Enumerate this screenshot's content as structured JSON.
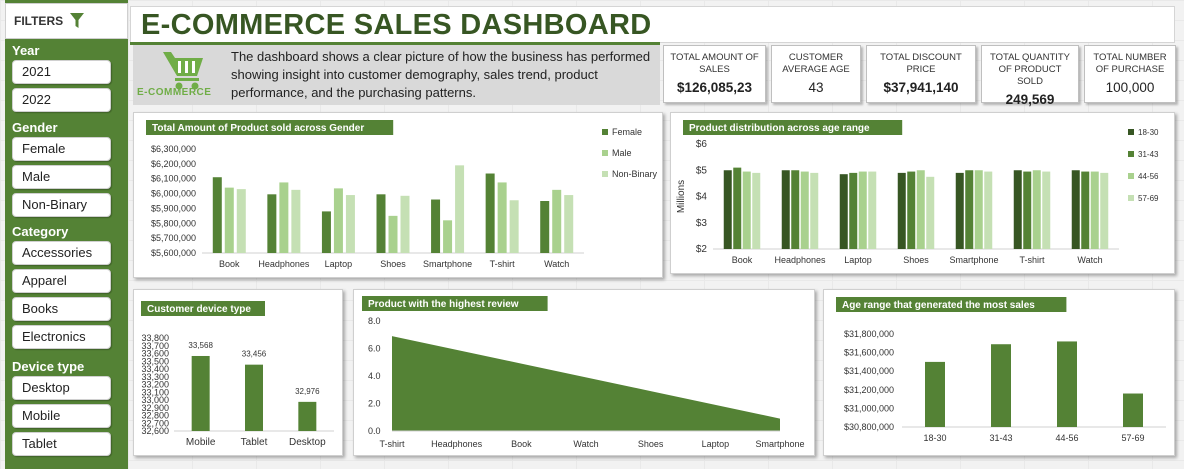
{
  "filters": {
    "label": "FILTERS",
    "groups": [
      {
        "title": "Year",
        "items": [
          "2021",
          "2022"
        ]
      },
      {
        "title": "Gender",
        "items": [
          "Female",
          "Male",
          "Non-Binary"
        ]
      },
      {
        "title": "Category",
        "items": [
          "Accessories",
          "Apparel",
          "Books",
          "Electronics"
        ]
      },
      {
        "title": "Device type",
        "items": [
          "Desktop",
          "Mobile",
          "Tablet"
        ]
      }
    ]
  },
  "header": {
    "title": "E-COMMERCE SALES DASHBOARD",
    "logo_text": "E-COMMERCE",
    "description": "The dashboard shows a clear picture of how the business has performed showing insight into customer demography, sales trend, product performance, and the purchasing patterns."
  },
  "kpis": [
    {
      "label": "TOTAL AMOUNT OF SALES",
      "value": "$126,085,23"
    },
    {
      "label": "CUSTOMER AVERAGE AGE",
      "value": "43"
    },
    {
      "label": "TOTAL DISCOUNT PRICE",
      "value": "$37,941,140"
    },
    {
      "label": "TOTAL QUANTITY OF PRODUCT SOLD",
      "value": "249,569"
    },
    {
      "label": "TOTAL NUMBER OF PURCHASE",
      "value": "100,000"
    }
  ],
  "colors": {
    "dark": "#548235",
    "mid": "#a9d18e",
    "light": "#c5e0b4",
    "vdark": "#375623",
    "title": "#375623"
  },
  "chart_data": [
    {
      "id": "gender",
      "type": "bar",
      "title": "Total Amount of Product sold across Gender",
      "categories": [
        "Book",
        "Headphones",
        "Laptop",
        "Shoes",
        "Smartphone",
        "T-shirt",
        "Watch"
      ],
      "series": [
        {
          "name": "Female",
          "values": [
            6110000,
            5995000,
            5880000,
            5995000,
            5960000,
            6135000,
            5950000
          ]
        },
        {
          "name": "Male",
          "values": [
            6040000,
            6075000,
            6035000,
            5850000,
            5820000,
            6075000,
            6025000
          ]
        },
        {
          "name": "Non-Binary",
          "values": [
            6030000,
            6025000,
            5990000,
            5985000,
            6190000,
            5955000,
            5990000
          ]
        }
      ],
      "yticks": [
        "$5,600,000",
        "$5,700,000",
        "$5,800,000",
        "$5,900,000",
        "$6,000,000",
        "$6,100,000",
        "$6,200,000",
        "$6,300,000"
      ],
      "ylim": [
        5600000,
        6300000
      ],
      "legend": "right"
    },
    {
      "id": "age",
      "type": "bar",
      "title": "Product distribution across age range",
      "ylabel": "Millions",
      "categories": [
        "Book",
        "Headphones",
        "Laptop",
        "Shoes",
        "Smartphone",
        "T-shirt",
        "Watch"
      ],
      "series": [
        {
          "name": "18-30",
          "values": [
            5.0,
            5.0,
            4.85,
            4.9,
            4.9,
            5.0,
            5.0
          ]
        },
        {
          "name": "31-43",
          "values": [
            5.1,
            5.0,
            4.9,
            4.95,
            5.0,
            4.95,
            4.95
          ]
        },
        {
          "name": "44-56",
          "values": [
            4.95,
            4.95,
            4.95,
            5.0,
            5.0,
            5.0,
            4.95
          ]
        },
        {
          "name": "57-69",
          "values": [
            4.9,
            4.9,
            4.95,
            4.75,
            4.95,
            4.95,
            4.9
          ]
        }
      ],
      "yticks": [
        "$2",
        "$3",
        "$4",
        "$5",
        "$6"
      ],
      "ylim": [
        2,
        6
      ],
      "legend": "right"
    },
    {
      "id": "device",
      "type": "bar",
      "title": "Customer device type",
      "categories": [
        "Mobile",
        "Tablet",
        "Desktop"
      ],
      "values": [
        33568,
        33456,
        32976
      ],
      "data_labels": [
        "33,568",
        "33,456",
        "32,976"
      ],
      "yticks": [
        "32,600",
        "32,700",
        "32,800",
        "32,900",
        "33,000",
        "33,100",
        "33,200",
        "33,300",
        "33,400",
        "33,500",
        "33,600",
        "33,700",
        "33,800"
      ],
      "ylim": [
        32600,
        33800
      ]
    },
    {
      "id": "review",
      "type": "area",
      "title": "Product with the highest review",
      "categories": [
        "T-shirt",
        "Headphones",
        "Book",
        "Watch",
        "Shoes",
        "Laptop",
        "Smartphone"
      ],
      "values": [
        6.9,
        5.9,
        4.9,
        3.9,
        2.9,
        1.9,
        0.9
      ],
      "yticks": [
        "0.0",
        "2.0",
        "4.0",
        "6.0",
        "8.0"
      ],
      "ylim": [
        0,
        8
      ]
    },
    {
      "id": "agesales",
      "type": "bar",
      "title": "Age range that generated the most sales",
      "categories": [
        "18-30",
        "31-43",
        "44-56",
        "57-69"
      ],
      "values": [
        31500000,
        31690000,
        31720000,
        31160000
      ],
      "yticks": [
        "$30,800,000",
        "$31,000,000",
        "$31,200,000",
        "$31,400,000",
        "$31,600,000",
        "$31,800,000"
      ],
      "ylim": [
        30800000,
        31800000
      ]
    }
  ]
}
